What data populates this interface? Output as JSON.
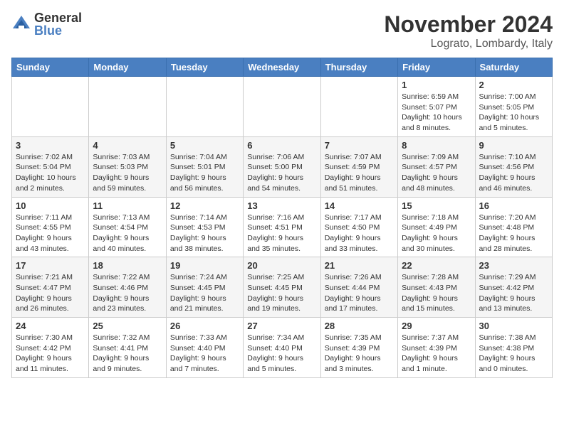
{
  "header": {
    "logo_general": "General",
    "logo_blue": "Blue",
    "month_title": "November 2024",
    "location": "Lograto, Lombardy, Italy"
  },
  "days_of_week": [
    "Sunday",
    "Monday",
    "Tuesday",
    "Wednesday",
    "Thursday",
    "Friday",
    "Saturday"
  ],
  "weeks": [
    [
      {
        "day": "",
        "info": ""
      },
      {
        "day": "",
        "info": ""
      },
      {
        "day": "",
        "info": ""
      },
      {
        "day": "",
        "info": ""
      },
      {
        "day": "",
        "info": ""
      },
      {
        "day": "1",
        "info": "Sunrise: 6:59 AM\nSunset: 5:07 PM\nDaylight: 10 hours\nand 8 minutes."
      },
      {
        "day": "2",
        "info": "Sunrise: 7:00 AM\nSunset: 5:05 PM\nDaylight: 10 hours\nand 5 minutes."
      }
    ],
    [
      {
        "day": "3",
        "info": "Sunrise: 7:02 AM\nSunset: 5:04 PM\nDaylight: 10 hours\nand 2 minutes."
      },
      {
        "day": "4",
        "info": "Sunrise: 7:03 AM\nSunset: 5:03 PM\nDaylight: 9 hours\nand 59 minutes."
      },
      {
        "day": "5",
        "info": "Sunrise: 7:04 AM\nSunset: 5:01 PM\nDaylight: 9 hours\nand 56 minutes."
      },
      {
        "day": "6",
        "info": "Sunrise: 7:06 AM\nSunset: 5:00 PM\nDaylight: 9 hours\nand 54 minutes."
      },
      {
        "day": "7",
        "info": "Sunrise: 7:07 AM\nSunset: 4:59 PM\nDaylight: 9 hours\nand 51 minutes."
      },
      {
        "day": "8",
        "info": "Sunrise: 7:09 AM\nSunset: 4:57 PM\nDaylight: 9 hours\nand 48 minutes."
      },
      {
        "day": "9",
        "info": "Sunrise: 7:10 AM\nSunset: 4:56 PM\nDaylight: 9 hours\nand 46 minutes."
      }
    ],
    [
      {
        "day": "10",
        "info": "Sunrise: 7:11 AM\nSunset: 4:55 PM\nDaylight: 9 hours\nand 43 minutes."
      },
      {
        "day": "11",
        "info": "Sunrise: 7:13 AM\nSunset: 4:54 PM\nDaylight: 9 hours\nand 40 minutes."
      },
      {
        "day": "12",
        "info": "Sunrise: 7:14 AM\nSunset: 4:53 PM\nDaylight: 9 hours\nand 38 minutes."
      },
      {
        "day": "13",
        "info": "Sunrise: 7:16 AM\nSunset: 4:51 PM\nDaylight: 9 hours\nand 35 minutes."
      },
      {
        "day": "14",
        "info": "Sunrise: 7:17 AM\nSunset: 4:50 PM\nDaylight: 9 hours\nand 33 minutes."
      },
      {
        "day": "15",
        "info": "Sunrise: 7:18 AM\nSunset: 4:49 PM\nDaylight: 9 hours\nand 30 minutes."
      },
      {
        "day": "16",
        "info": "Sunrise: 7:20 AM\nSunset: 4:48 PM\nDaylight: 9 hours\nand 28 minutes."
      }
    ],
    [
      {
        "day": "17",
        "info": "Sunrise: 7:21 AM\nSunset: 4:47 PM\nDaylight: 9 hours\nand 26 minutes."
      },
      {
        "day": "18",
        "info": "Sunrise: 7:22 AM\nSunset: 4:46 PM\nDaylight: 9 hours\nand 23 minutes."
      },
      {
        "day": "19",
        "info": "Sunrise: 7:24 AM\nSunset: 4:45 PM\nDaylight: 9 hours\nand 21 minutes."
      },
      {
        "day": "20",
        "info": "Sunrise: 7:25 AM\nSunset: 4:45 PM\nDaylight: 9 hours\nand 19 minutes."
      },
      {
        "day": "21",
        "info": "Sunrise: 7:26 AM\nSunset: 4:44 PM\nDaylight: 9 hours\nand 17 minutes."
      },
      {
        "day": "22",
        "info": "Sunrise: 7:28 AM\nSunset: 4:43 PM\nDaylight: 9 hours\nand 15 minutes."
      },
      {
        "day": "23",
        "info": "Sunrise: 7:29 AM\nSunset: 4:42 PM\nDaylight: 9 hours\nand 13 minutes."
      }
    ],
    [
      {
        "day": "24",
        "info": "Sunrise: 7:30 AM\nSunset: 4:42 PM\nDaylight: 9 hours\nand 11 minutes."
      },
      {
        "day": "25",
        "info": "Sunrise: 7:32 AM\nSunset: 4:41 PM\nDaylight: 9 hours\nand 9 minutes."
      },
      {
        "day": "26",
        "info": "Sunrise: 7:33 AM\nSunset: 4:40 PM\nDaylight: 9 hours\nand 7 minutes."
      },
      {
        "day": "27",
        "info": "Sunrise: 7:34 AM\nSunset: 4:40 PM\nDaylight: 9 hours\nand 5 minutes."
      },
      {
        "day": "28",
        "info": "Sunrise: 7:35 AM\nSunset: 4:39 PM\nDaylight: 9 hours\nand 3 minutes."
      },
      {
        "day": "29",
        "info": "Sunrise: 7:37 AM\nSunset: 4:39 PM\nDaylight: 9 hours\nand 1 minute."
      },
      {
        "day": "30",
        "info": "Sunrise: 7:38 AM\nSunset: 4:38 PM\nDaylight: 9 hours\nand 0 minutes."
      }
    ]
  ]
}
